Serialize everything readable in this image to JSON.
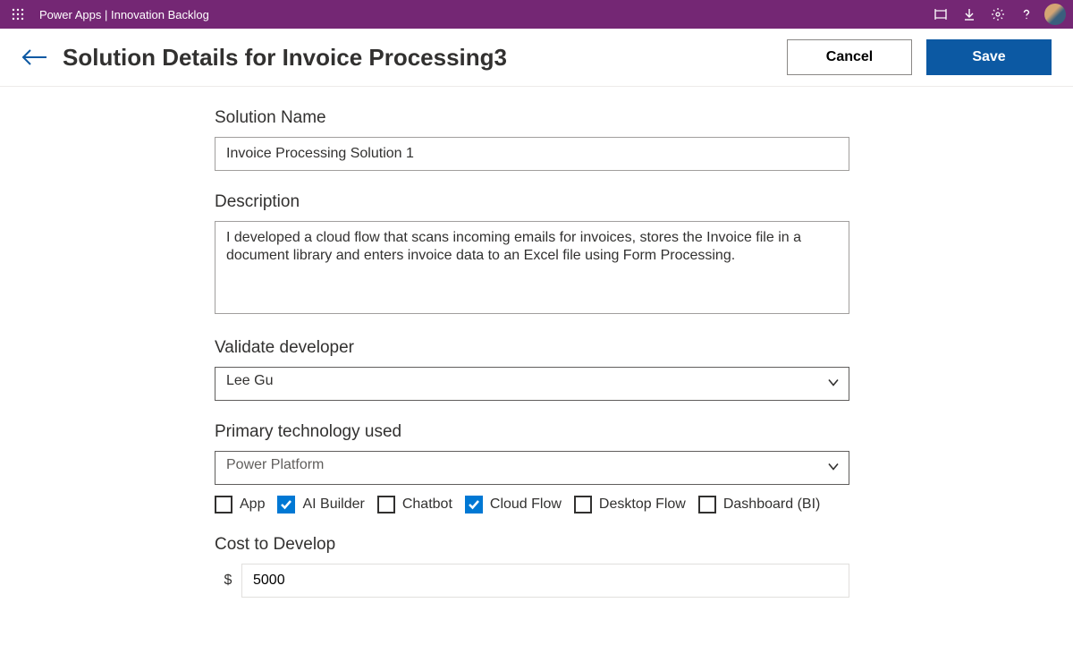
{
  "topbar": {
    "title": "Power Apps   |   Innovation Backlog"
  },
  "header": {
    "title": "Solution Details for Invoice Processing3",
    "cancel": "Cancel",
    "save": "Save"
  },
  "form": {
    "solution_name": {
      "label": "Solution Name",
      "value": "Invoice Processing Solution 1"
    },
    "description": {
      "label": "Description",
      "value": "I developed a cloud flow that scans incoming emails for invoices, stores the Invoice file in a document library and enters invoice data to an Excel file using Form Processing."
    },
    "validate_developer": {
      "label": "Validate developer",
      "value": "Lee Gu"
    },
    "primary_tech": {
      "label": "Primary technology used",
      "value": "Power Platform",
      "options": [
        {
          "label": "App",
          "checked": false
        },
        {
          "label": "AI Builder",
          "checked": true
        },
        {
          "label": "Chatbot",
          "checked": false
        },
        {
          "label": "Cloud Flow",
          "checked": true
        },
        {
          "label": "Desktop Flow",
          "checked": false
        },
        {
          "label": "Dashboard (BI)",
          "checked": false
        }
      ]
    },
    "cost": {
      "label": "Cost to Develop",
      "currency": "$",
      "value": "5000"
    }
  }
}
